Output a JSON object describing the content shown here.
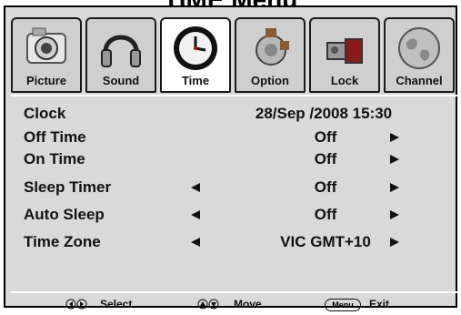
{
  "window_title": "TIME Menu",
  "tabs": [
    {
      "label": "Picture",
      "icon": "camera-icon",
      "active": false
    },
    {
      "label": "Sound",
      "icon": "headphones-icon",
      "active": false
    },
    {
      "label": "Time",
      "icon": "clock-icon",
      "active": true
    },
    {
      "label": "Option",
      "icon": "gear-icon",
      "active": false
    },
    {
      "label": "Lock",
      "icon": "lock-icon",
      "active": false
    },
    {
      "label": "Channel",
      "icon": "globe-icon",
      "active": false
    }
  ],
  "rows": [
    {
      "label": "Clock",
      "value": "28/Sep  /2008 15:30",
      "has_left": false,
      "has_right": false
    },
    {
      "label": "Off Time",
      "value": "Off",
      "has_left": false,
      "has_right": true
    },
    {
      "label": "On Time",
      "value": "Off",
      "has_left": false,
      "has_right": true
    },
    {
      "label": "Sleep Timer",
      "value": "Off",
      "has_left": true,
      "has_right": true
    },
    {
      "label": "Auto Sleep",
      "value": "Off",
      "has_left": true,
      "has_right": true
    },
    {
      "label": "Time Zone",
      "value": "VIC GMT+10",
      "has_left": true,
      "has_right": true
    }
  ],
  "footer": {
    "select_label": "Select",
    "move_label": "Move",
    "menu_key": "Menu",
    "exit_label": "Exit"
  }
}
